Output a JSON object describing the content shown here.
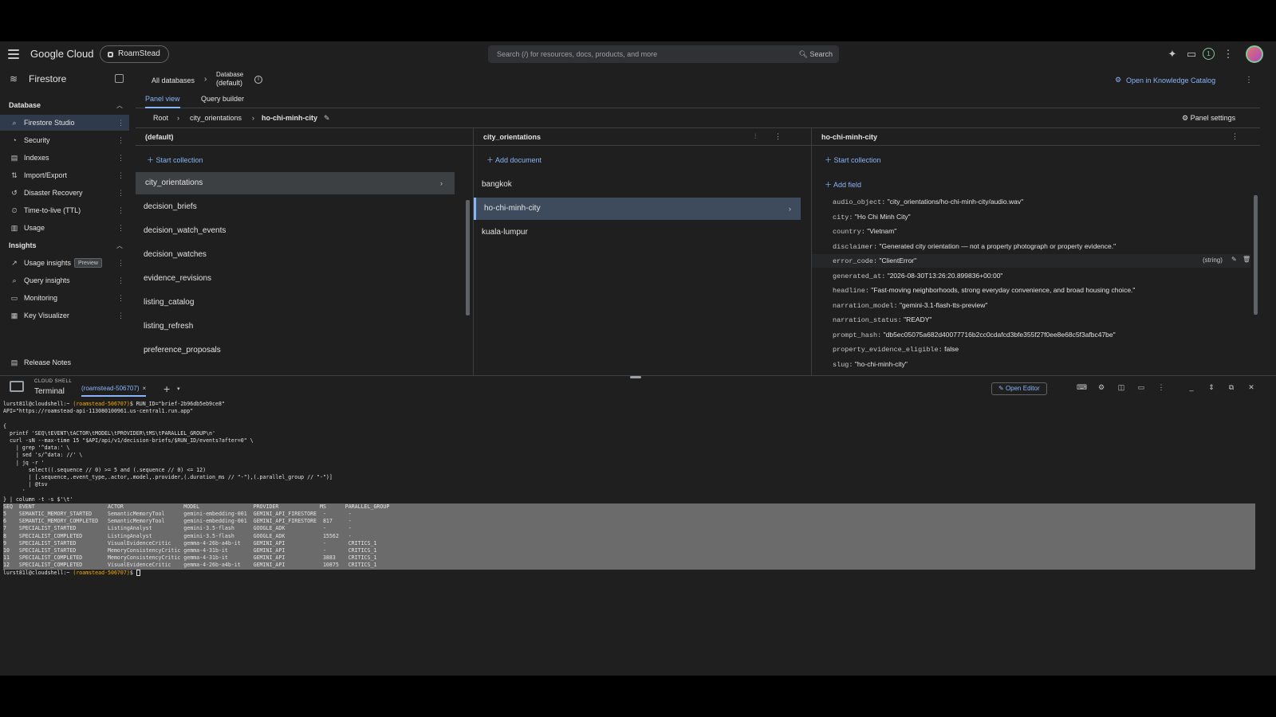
{
  "topbar": {
    "logo": "Google Cloud",
    "project": "RoamStead",
    "search_placeholder": "Search (/) for resources, docs, products, and more",
    "search_button": "Search",
    "notification_count": "1"
  },
  "product": {
    "name": "Firestore",
    "breadcrumb_all": "All databases",
    "breadcrumb_db_label": "Database",
    "breadcrumb_db_value": "(default)",
    "knowledge_catalog": "Open in Knowledge Catalog"
  },
  "sidebar": {
    "section_database": "Database",
    "section_insights": "Insights",
    "items": [
      {
        "label": "Firestore Studio",
        "icon": "search-icon"
      },
      {
        "label": "Security",
        "icon": "shield-icon"
      },
      {
        "label": "Indexes",
        "icon": "index-icon"
      },
      {
        "label": "Import/Export",
        "icon": "import-export-icon"
      },
      {
        "label": "Disaster Recovery",
        "icon": "history-icon"
      },
      {
        "label": "Time-to-live (TTL)",
        "icon": "timer-icon"
      },
      {
        "label": "Usage",
        "icon": "bar-chart-icon"
      }
    ],
    "insight_items": [
      {
        "label": "Usage insights",
        "badge": "Preview",
        "icon": "trend-icon"
      },
      {
        "label": "Query insights",
        "icon": "query-icon"
      },
      {
        "label": "Monitoring",
        "icon": "monitor-icon"
      },
      {
        "label": "Key Visualizer",
        "icon": "grid-icon"
      }
    ],
    "release_notes": "Release Notes"
  },
  "tabs": {
    "panel_view": "Panel view",
    "query_builder": "Query builder"
  },
  "path": {
    "root": "Root",
    "collection": "city_orientations",
    "document": "ho-chi-minh-city",
    "panel_settings": "Panel settings"
  },
  "panel_db": {
    "title": "(default)",
    "start_collection": "Start collection",
    "collections": [
      "city_orientations",
      "decision_briefs",
      "decision_watch_events",
      "decision_watches",
      "evidence_revisions",
      "listing_catalog",
      "listing_refresh",
      "preference_proposals"
    ]
  },
  "panel_coll": {
    "title": "city_orientations",
    "add_document": "Add document",
    "documents": [
      "bangkok",
      "ho-chi-minh-city",
      "kuala-lumpur"
    ]
  },
  "panel_doc": {
    "title": "ho-chi-minh-city",
    "start_collection": "Start collection",
    "add_field": "Add field",
    "fields": [
      {
        "key": "audio_object:",
        "value": "\"city_orientations/ho-chi-minh-city/audio.wav\""
      },
      {
        "key": "city:",
        "value": "\"Ho Chi Minh City\""
      },
      {
        "key": "country:",
        "value": "\"Vietnam\""
      },
      {
        "key": "disclaimer:",
        "value": "\"Generated city orientation — not a property photograph or property evidence.\""
      },
      {
        "key": "error_code:",
        "value": "\"ClientError\""
      },
      {
        "key": "generated_at:",
        "value": "\"2026-08-30T13:26:20.899836+00:00\""
      },
      {
        "key": "headline:",
        "value": "\"Fast-moving neighborhoods, strong everyday convenience, and broad housing choice.\""
      },
      {
        "key": "narration_model:",
        "value": "\"gemini-3.1-flash-tts-preview\""
      },
      {
        "key": "narration_status:",
        "value": "\"READY\""
      },
      {
        "key": "prompt_hash:",
        "value": "\"db5ec05075a682d40077716b2cc0cdafcd3bfe355f27f0ee8e68c5f3afbc47be\""
      },
      {
        "key": "property_evidence_eligible:",
        "value": "false"
      },
      {
        "key": "slug:",
        "value": "\"ho-chi-minh-city\""
      }
    ],
    "hover_type": "(string)"
  },
  "terminal": {
    "cloud_shell": "CLOUD SHELL",
    "title": "Terminal",
    "tab": "(roamstead-506707)",
    "open_editor": "Open Editor",
    "lines": [
      {
        "prompt": "lurst81l@cloudshell:~ ",
        "project": "(roamstead-506707)",
        "cmd": "$ RUN_ID=\"brief-2b96db5eb9ce8\""
      },
      {
        "text": "API=\"https://roamstead-api-113080100961.us-central1.run.app\""
      },
      {
        "text": ""
      },
      {
        "text": "{"
      },
      {
        "text": "  printf 'SEQ\\tEVENT\\tACTOR\\tMODEL\\tPROVIDER\\tMS\\tPARALLEL_GROUP\\n'"
      },
      {
        "text": "  curl -sN --max-time 15 \"$API/api/v1/decision-briefs/$RUN_ID/events?after=0\" \\"
      },
      {
        "text": "    | grep '^data:' \\"
      },
      {
        "text": "    | sed 's/^data: //' \\"
      },
      {
        "text": "    | jq -r '"
      },
      {
        "text": "        select((.sequence // 0) >= 5 and (.sequence // 0) <= 12)"
      },
      {
        "text": "        | [.sequence,.event_type,.actor,.model,.provider,(.duration_ms // \"-\"),(.parallel_group // \"-\")]"
      },
      {
        "text": "        | @tsv"
      },
      {
        "text": "      '"
      },
      {
        "text": "} | column -t -s $'\\t'"
      }
    ],
    "table": [
      "SEQ  EVENT                       ACTOR                   MODEL                 PROVIDER             MS      PARALLEL_GROUP",
      "5    SEMANTIC_MEMORY_STARTED     SemanticMemoryTool      gemini-embedding-001  GEMINI_API_FIRESTORE  -       -",
      "6    SEMANTIC_MEMORY_COMPLETED   SemanticMemoryTool      gemini-embedding-001  GEMINI_API_FIRESTORE  817     -",
      "7    SPECIALIST_STARTED          ListingAnalyst          gemini-3.5-flash      GOOGLE_ADK            -       -",
      "8    SPECIALIST_COMPLETED        ListingAnalyst          gemini-3.5-flash      GOOGLE_ADK            15562   -",
      "9    SPECIALIST_STARTED          VisualEvidenceCritic    gemma-4-26b-a4b-it    GEMINI_API            -       CRITICS_1",
      "10   SPECIALIST_STARTED          MemoryConsistencyCritic gemma-4-31b-it        GEMINI_API            -       CRITICS_1",
      "11   SPECIALIST_COMPLETED        MemoryConsistencyCritic gemma-4-31b-it        GEMINI_API            3883    CRITICS_1",
      "12   SPECIALIST_COMPLETED        VisualEvidenceCritic    gemma-4-26b-a4b-it    GEMINI_API            10875   CRITICS_1"
    ],
    "final_prompt": "lurst81l@cloudshell:~ ",
    "final_project": "(roamstead-506707)",
    "final_cmd": "$ "
  }
}
